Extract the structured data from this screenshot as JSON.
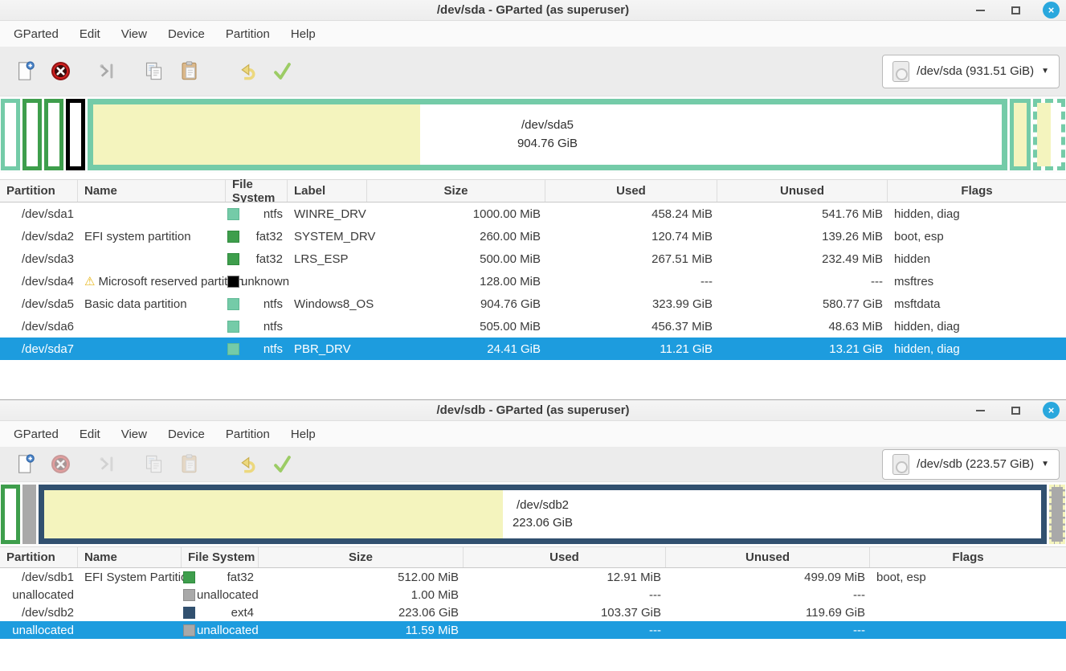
{
  "menu": [
    "GParted",
    "Edit",
    "View",
    "Device",
    "Partition",
    "Help"
  ],
  "icons": {
    "dropdown": "▼",
    "close": "×",
    "warning": "⚠"
  },
  "colors": {
    "ntfs": {
      "fill": "#74CBA8",
      "border": "#5FB894"
    },
    "fat32": {
      "fill": "#3E9E4C",
      "border": "#2F8A3D"
    },
    "unknown": {
      "fill": "#000000",
      "border": "#7A7A7A"
    },
    "unallocated": {
      "fill": "#A9A9A9",
      "border": "#8C8C8C"
    },
    "ext4": {
      "fill": "#31506F",
      "border": "#31506F"
    },
    "used": "#F4F4BE",
    "selection": "#1D9CDE"
  },
  "windows": [
    {
      "title": "/dev/sda - GParted (as superuser)",
      "device": "/dev/sda (931.51 GiB)",
      "visual": {
        "segments": [
          {
            "name": "/dev/sda1",
            "fs": "ntfs",
            "width": 14,
            "used_pct": 0,
            "solid": false,
            "selected": false
          },
          {
            "name": "/dev/sda2",
            "fs": "fat32",
            "width": 14,
            "used_pct": 0,
            "solid": false,
            "selected": false
          },
          {
            "name": "/dev/sda3",
            "fs": "fat32",
            "width": 14,
            "used_pct": 0,
            "solid": false,
            "selected": false
          },
          {
            "name": "/dev/sda4",
            "fs": "unknown",
            "width": 14,
            "used_pct": 0,
            "solid": false,
            "selected": false
          },
          {
            "name": "/dev/sda5",
            "fs": "ntfs",
            "width": "grow",
            "used_pct": 36,
            "solid": false,
            "selected": false,
            "label1": "/dev/sda5",
            "label2": "904.76 GiB"
          },
          {
            "name": "/dev/sda6",
            "fs": "ntfs",
            "width": 16,
            "used_pct": 100,
            "solid": false,
            "selected": false
          },
          {
            "name": "/dev/sda7",
            "fs": "ntfs",
            "width": 30,
            "used_pct": 55,
            "solid": false,
            "selected": true
          }
        ]
      },
      "table": {
        "headers": [
          "Partition",
          "Name",
          "File System",
          "Label",
          "Size",
          "Used",
          "Unused",
          "Flags"
        ],
        "rows": [
          {
            "partition": "/dev/sda1",
            "warning": false,
            "name": "",
            "fs": "ntfs",
            "label": "WINRE_DRV",
            "size": "1000.00 MiB",
            "used": "458.24 MiB",
            "unused": "541.76 MiB",
            "flags": "hidden, diag",
            "selected": false
          },
          {
            "partition": "/dev/sda2",
            "warning": false,
            "name": "EFI system partition",
            "fs": "fat32",
            "label": "SYSTEM_DRV",
            "size": "260.00 MiB",
            "used": "120.74 MiB",
            "unused": "139.26 MiB",
            "flags": "boot, esp",
            "selected": false
          },
          {
            "partition": "/dev/sda3",
            "warning": false,
            "name": "",
            "fs": "fat32",
            "label": "LRS_ESP",
            "size": "500.00 MiB",
            "used": "267.51 MiB",
            "unused": "232.49 MiB",
            "flags": "hidden",
            "selected": false
          },
          {
            "partition": "/dev/sda4",
            "warning": true,
            "name": "Microsoft reserved partition",
            "fs": "unknown",
            "label": "",
            "size": "128.00 MiB",
            "used": "---",
            "unused": "---",
            "flags": "msftres",
            "selected": false
          },
          {
            "partition": "/dev/sda5",
            "warning": false,
            "name": "Basic data partition",
            "fs": "ntfs",
            "label": "Windows8_OS",
            "size": "904.76 GiB",
            "used": "323.99 GiB",
            "unused": "580.77 GiB",
            "flags": "msftdata",
            "selected": false
          },
          {
            "partition": "/dev/sda6",
            "warning": false,
            "name": "",
            "fs": "ntfs",
            "label": "",
            "size": "505.00 MiB",
            "used": "456.37 MiB",
            "unused": "48.63 MiB",
            "flags": "hidden, diag",
            "selected": false
          },
          {
            "partition": "/dev/sda7",
            "warning": false,
            "name": "",
            "fs": "ntfs",
            "label": "PBR_DRV",
            "size": "24.41 GiB",
            "used": "11.21 GiB",
            "unused": "13.21 GiB",
            "flags": "hidden, diag",
            "selected": true
          }
        ]
      }
    },
    {
      "title": "/dev/sdb - GParted (as superuser)",
      "device": "/dev/sdb (223.57 GiB)",
      "visual": {
        "segments": [
          {
            "name": "/dev/sdb1",
            "fs": "fat32",
            "width": 14,
            "used_pct": 0,
            "solid": false,
            "selected": false
          },
          {
            "name": "unallocated",
            "fs": "unallocated",
            "width": 13,
            "used_pct": 0,
            "solid": true,
            "selected": false
          },
          {
            "name": "/dev/sdb2",
            "fs": "ext4",
            "width": "grow",
            "used_pct": 46,
            "solid": false,
            "selected": false,
            "label1": "/dev/sdb2",
            "label2": "223.06 GiB"
          },
          {
            "name": "unallocated",
            "fs": "unallocated",
            "width": 16,
            "used_pct": 0,
            "solid": true,
            "selected": true
          }
        ]
      },
      "table": {
        "headers": [
          "Partition",
          "Name",
          "File System",
          "Size",
          "Used",
          "Unused",
          "Flags"
        ],
        "rows": [
          {
            "partition": "/dev/sdb1",
            "warning": false,
            "name": "EFI System Partition",
            "fs": "fat32",
            "size": "512.00 MiB",
            "used": "12.91 MiB",
            "unused": "499.09 MiB",
            "flags": "boot, esp",
            "selected": false
          },
          {
            "partition": "unallocated",
            "warning": false,
            "name": "",
            "fs": "unallocated",
            "size": "1.00 MiB",
            "used": "---",
            "unused": "---",
            "flags": "",
            "selected": false
          },
          {
            "partition": "/dev/sdb2",
            "warning": false,
            "name": "",
            "fs": "ext4",
            "size": "223.06 GiB",
            "used": "103.37 GiB",
            "unused": "119.69 GiB",
            "flags": "",
            "selected": false
          },
          {
            "partition": "unallocated",
            "warning": false,
            "name": "",
            "fs": "unallocated",
            "size": "11.59 MiB",
            "used": "---",
            "unused": "---",
            "flags": "",
            "selected": true
          }
        ]
      }
    }
  ]
}
